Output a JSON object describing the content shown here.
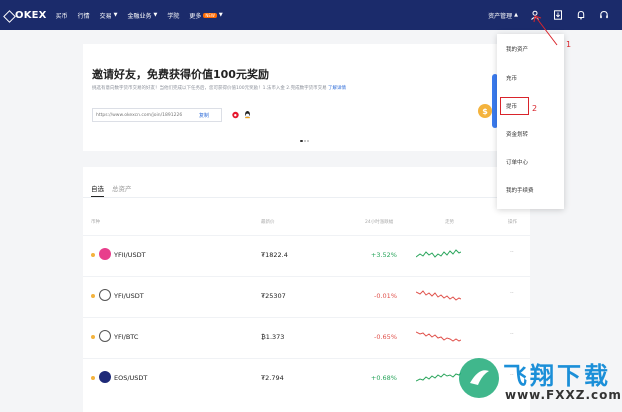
{
  "header": {
    "logo_text": "OKEX",
    "nav": [
      {
        "label": "买币"
      },
      {
        "label": "行情"
      },
      {
        "label": "交易"
      },
      {
        "label": "金融业务"
      },
      {
        "label": "学院"
      },
      {
        "label": "更多",
        "badge": "NEW"
      }
    ],
    "asset_menu_label": "资产管理",
    "icons": [
      "user-icon",
      "download-icon",
      "bell-icon",
      "headset-icon"
    ]
  },
  "invite": {
    "title": "邀请好友，免费获得价值100元奖励",
    "description": "挑选有意向数字货币交易的好友！当他们完成以下任务后，您可获得价值100元奖励！1.法币入金 2.完成数字货币交易",
    "rules_link": "了解详情",
    "invite_link": "https://www.okexcn.com/join/1891226",
    "copy_label": "复制",
    "coin_symbol": "$"
  },
  "favorites": {
    "tabs": [
      {
        "label": "自选",
        "active": true
      },
      {
        "label": "总资产",
        "active": false
      }
    ],
    "columns": [
      "币种",
      "最新价",
      "24小时涨跌幅",
      "走势",
      "操作"
    ],
    "rows": [
      {
        "pair": "YFII/USDT",
        "price": "₮1822.4",
        "change": "+3.52%",
        "trend": "up",
        "icon_color": "#e83e8c"
      },
      {
        "pair": "YFI/USDT",
        "price": "₮25307",
        "change": "-0.01%",
        "trend": "down",
        "icon_color": "#ffffff"
      },
      {
        "pair": "YFI/BTC",
        "price": "₿1.373",
        "change": "-0.65%",
        "trend": "down",
        "icon_color": "#ffffff"
      },
      {
        "pair": "EOS/USDT",
        "price": "₮2.794",
        "change": "+0.68%",
        "trend": "up",
        "icon_color": "#1e2a78"
      }
    ],
    "row_action": "··",
    "up_color": "#2aa55c",
    "down_color": "#e0524c"
  },
  "dropdown": {
    "items": [
      "我的资产",
      "充币",
      "提币",
      "资金划转",
      "订单中心",
      "我的手续费"
    ],
    "highlighted_item": "提币"
  },
  "annotations": {
    "step1": "1",
    "step2": "2",
    "color": "#d9242b"
  },
  "watermark": {
    "text": "飞翔下载",
    "url": "www.FXXZ.com"
  },
  "colors": {
    "topbar": "#1b2b6b",
    "accent": "#2d6bd8"
  }
}
